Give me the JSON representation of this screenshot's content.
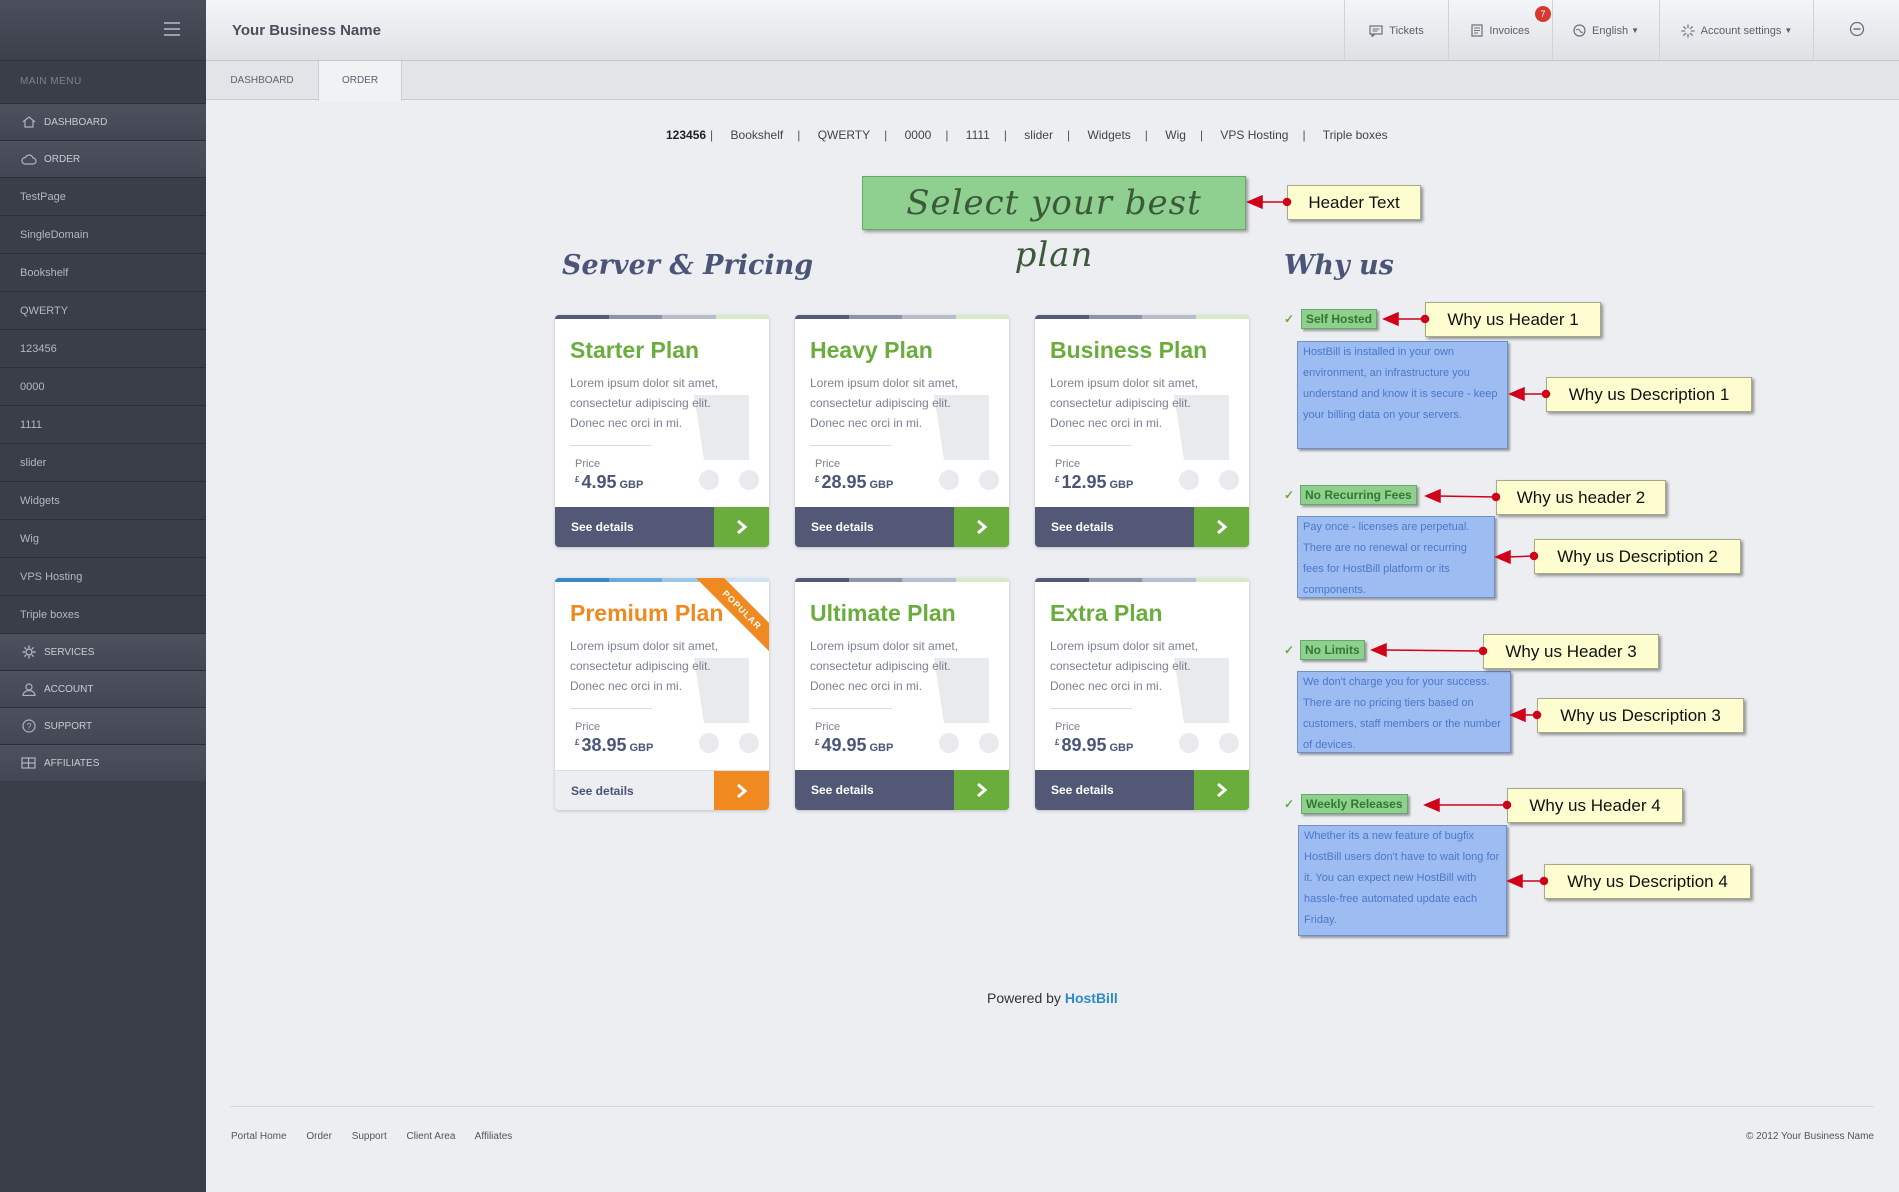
{
  "header": {
    "brand": "Your Business Name",
    "tickets": "Tickets",
    "invoices": "Invoices",
    "invoices_badge": "7",
    "language": "English",
    "account": "Account settings"
  },
  "sidebar": {
    "title": "MAIN MENU",
    "dashboard": "DASHBOARD",
    "order": "ORDER",
    "subitems": [
      "TestPage",
      "SingleDomain",
      "Bookshelf",
      "QWERTY",
      "123456",
      "0000",
      "1111",
      "slider",
      "Widgets",
      "Wig",
      "VPS Hosting",
      "Triple boxes"
    ],
    "services": "SERVICES",
    "account": "ACCOUNT",
    "support": "SUPPORT",
    "affiliates": "AFFILIATES"
  },
  "tabs": [
    "DASHBOARD",
    "ORDER"
  ],
  "catnav": [
    "123456",
    "Bookshelf",
    "QWERTY",
    "0000",
    "1111",
    "slider",
    "Widgets",
    "Wig",
    "VPS Hosting",
    "Triple boxes"
  ],
  "header_text": "Select your best plan",
  "server_title": "Server & Pricing",
  "why_title": "Why us",
  "plans": [
    {
      "name": "Starter Plan",
      "desc": "Lorem ipsum dolor sit amet, consectetur adipiscing elit. Donec nec orci in mi.",
      "price_label": "Price",
      "currency_symbol": "£",
      "price": "4.95",
      "currency": "GBP",
      "cta": "See details"
    },
    {
      "name": "Heavy Plan",
      "desc": "Lorem ipsum dolor sit amet, consectetur adipiscing elit. Donec nec orci in mi.",
      "price_label": "Price",
      "currency_symbol": "£",
      "price": "28.95",
      "currency": "GBP",
      "cta": "See details"
    },
    {
      "name": "Business Plan",
      "desc": "Lorem ipsum dolor sit amet, consectetur adipiscing elit. Donec nec orci in mi.",
      "price_label": "Price",
      "currency_symbol": "£",
      "price": "12.95",
      "currency": "GBP",
      "cta": "See details"
    },
    {
      "name": "Premium Plan",
      "desc": "Lorem ipsum dolor sit amet, consectetur adipiscing elit. Donec nec orci in mi.",
      "price_label": "Price",
      "currency_symbol": "£",
      "price": "38.95",
      "currency": "GBP",
      "cta": "See details",
      "ribbon": "POPULAR"
    },
    {
      "name": "Ultimate Plan",
      "desc": "Lorem ipsum dolor sit amet, consectetur adipiscing elit. Donec nec orci in mi.",
      "price_label": "Price",
      "currency_symbol": "£",
      "price": "49.95",
      "currency": "GBP",
      "cta": "See details"
    },
    {
      "name": "Extra Plan",
      "desc": "Lorem ipsum dolor sit amet, consectetur adipiscing elit. Donec nec orci in mi.",
      "price_label": "Price",
      "currency_symbol": "£",
      "price": "89.95",
      "currency": "GBP",
      "cta": "See details"
    }
  ],
  "why": [
    {
      "header": "Self Hosted",
      "desc": "HostBill is installed in your own environment, an infrastructure you understand and know it is secure - keep your billing data on your servers."
    },
    {
      "header": "No Recurring Fees",
      "desc": "Pay once - licenses are perpetual. There are no renewal or recurring fees for HostBill platform or its components."
    },
    {
      "header": "No Limits",
      "desc": "We don't charge you for your success. There are no pricing tiers based on customers, staff members or the number of devices."
    },
    {
      "header": "Weekly Releases",
      "desc": "Whether its a new feature of bugfix HostBill users don't have to wait long for it. You can expect new HostBill with hassle-free automated update each Friday."
    }
  ],
  "callouts": {
    "header_text": "Header Text",
    "why_h1": "Why us Header 1",
    "why_d1": "Why us Description 1",
    "why_h2": "Why us header 2",
    "why_d2": "Why us Description 2",
    "why_h3": "Why us Header 3",
    "why_d3": "Why us Description 3",
    "why_h4": "Why us Header 4",
    "why_d4": "Why us Description 4"
  },
  "powered_prefix": "Powered by",
  "powered_brand": "HostBill",
  "footer": {
    "links": [
      "Portal Home",
      "Order",
      "Support",
      "Client Area",
      "Affiliates"
    ],
    "copyright": "© 2012 Your Business Name"
  },
  "colors": {
    "green": "#6aad3d",
    "orange": "#f0891f",
    "navy": "#525876",
    "sidebar": "#3a3e49"
  }
}
